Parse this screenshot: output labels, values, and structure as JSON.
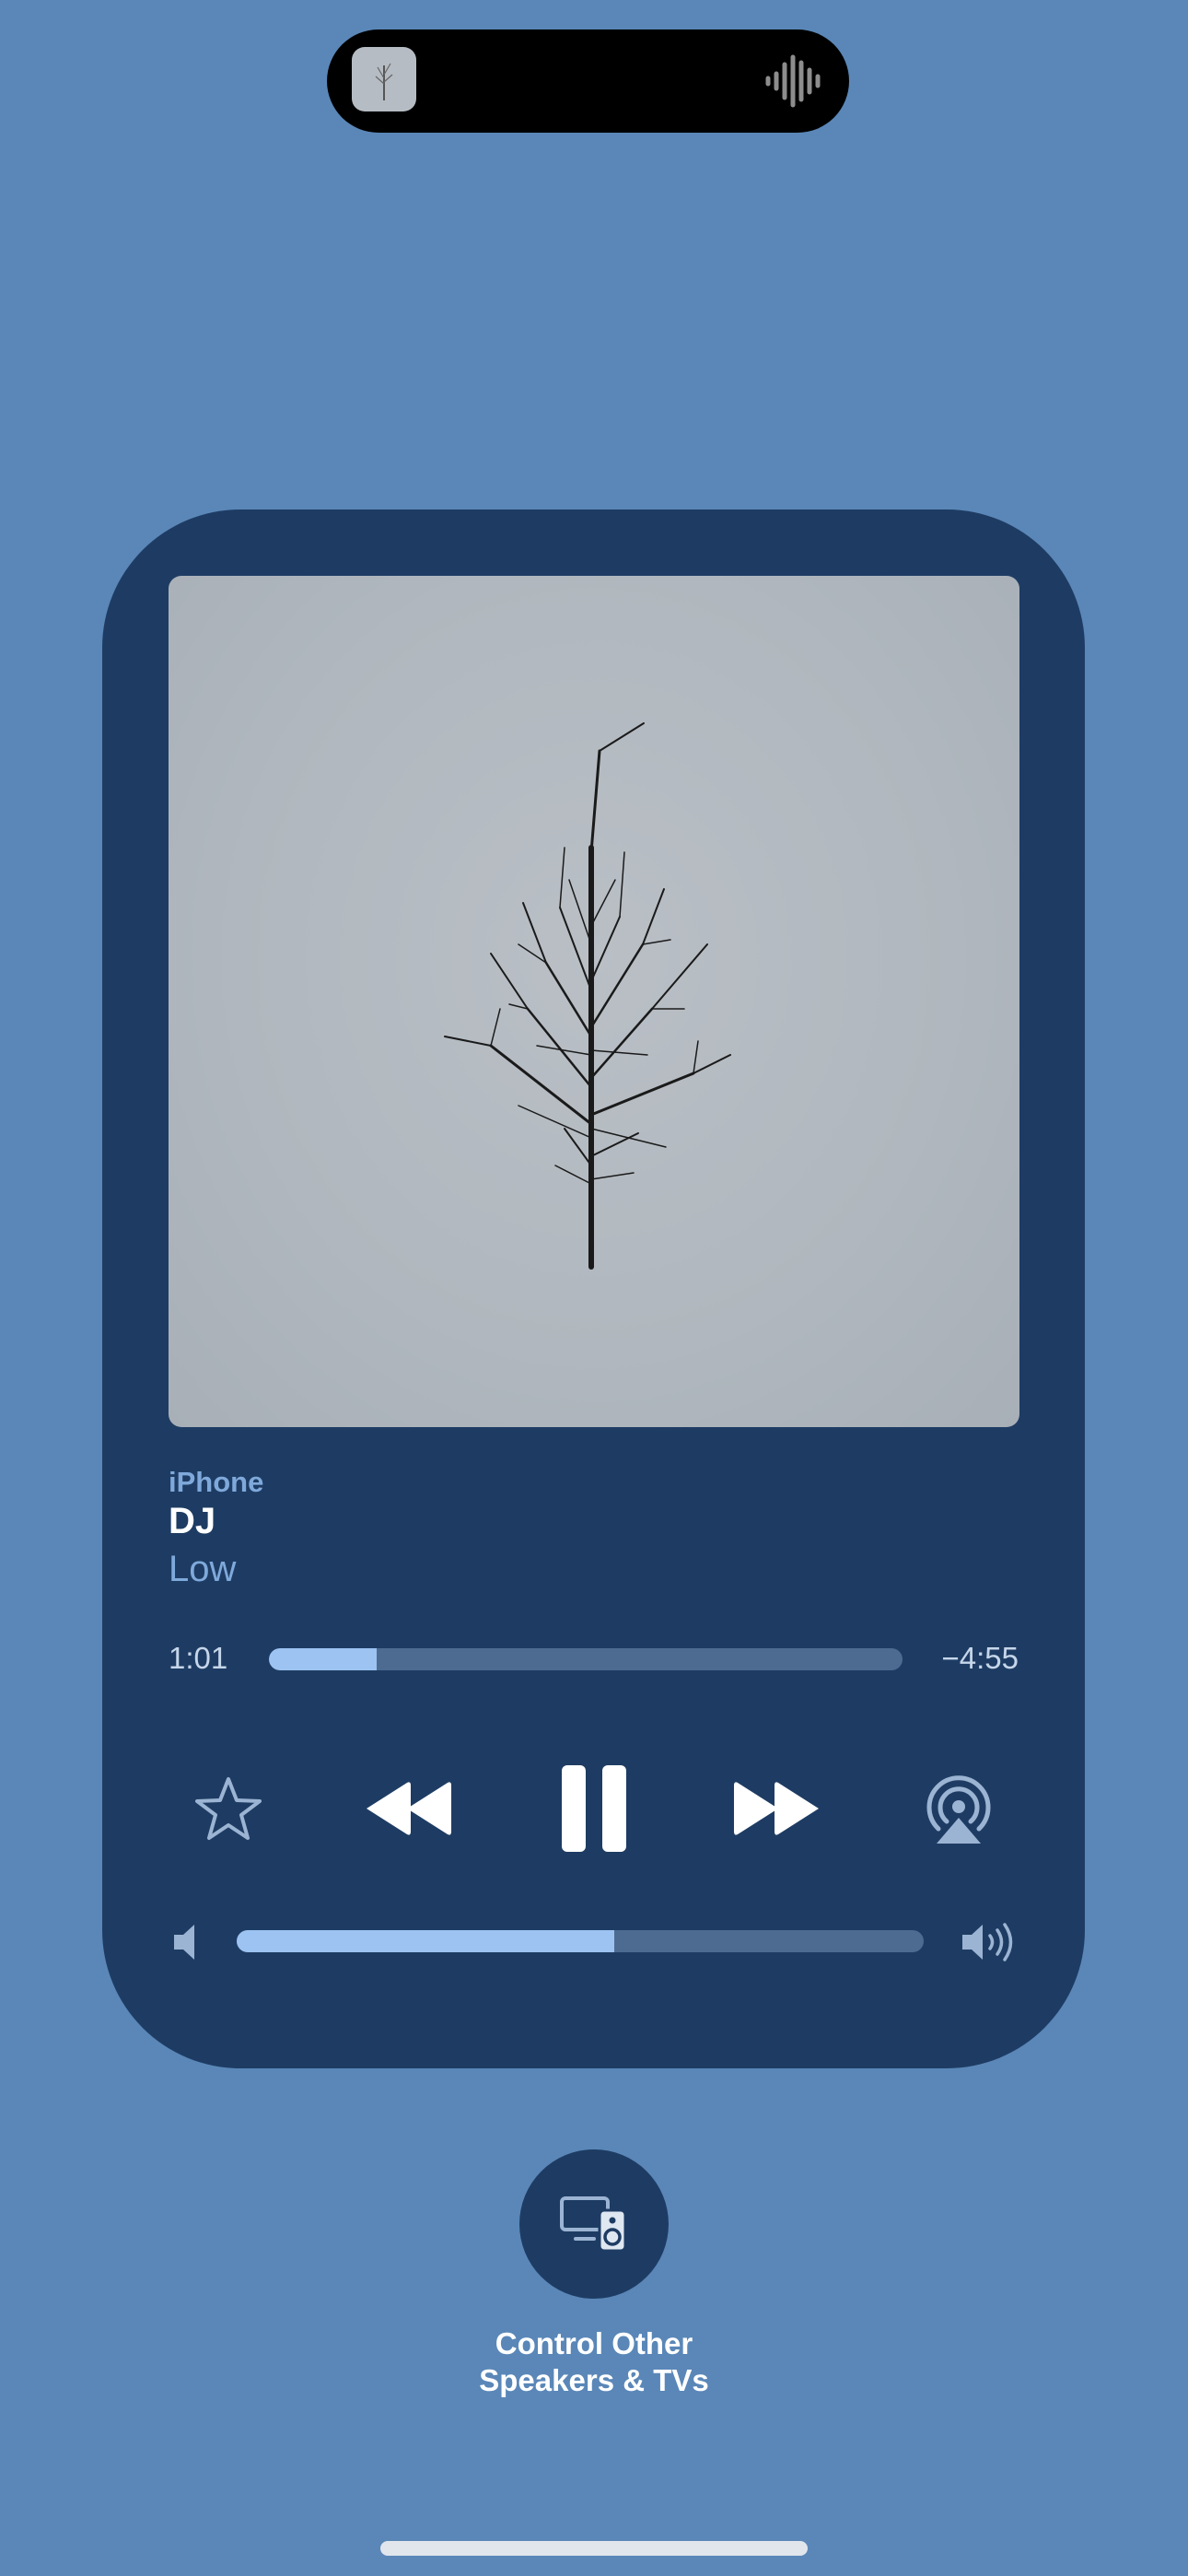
{
  "dynamic_island": {
    "art_icon": "album-thumbnail",
    "wave_icon": "audio-waveform-icon"
  },
  "now_playing": {
    "source": "iPhone",
    "title": "DJ",
    "artist": "Low",
    "elapsed": "1:01",
    "remaining": "−4:55",
    "progress": 0.17
  },
  "controls": {
    "favorite_icon": "star-icon",
    "previous_icon": "rewind-icon",
    "play_pause_icon": "pause-icon",
    "next_icon": "fast-forward-icon",
    "airplay_icon": "airplay-audio-icon"
  },
  "volume": {
    "level": 0.55,
    "min_icon": "speaker-low-icon",
    "max_icon": "speaker-high-icon"
  },
  "other_speakers": {
    "icon": "display-and-speaker-icon",
    "label_line1": "Control Other",
    "label_line2": "Speakers & TVs"
  },
  "colors": {
    "background": "#5a87b8",
    "card": "#1e3c63",
    "accent": "#9cc3f1",
    "secondary_text": "#7fa9db"
  }
}
